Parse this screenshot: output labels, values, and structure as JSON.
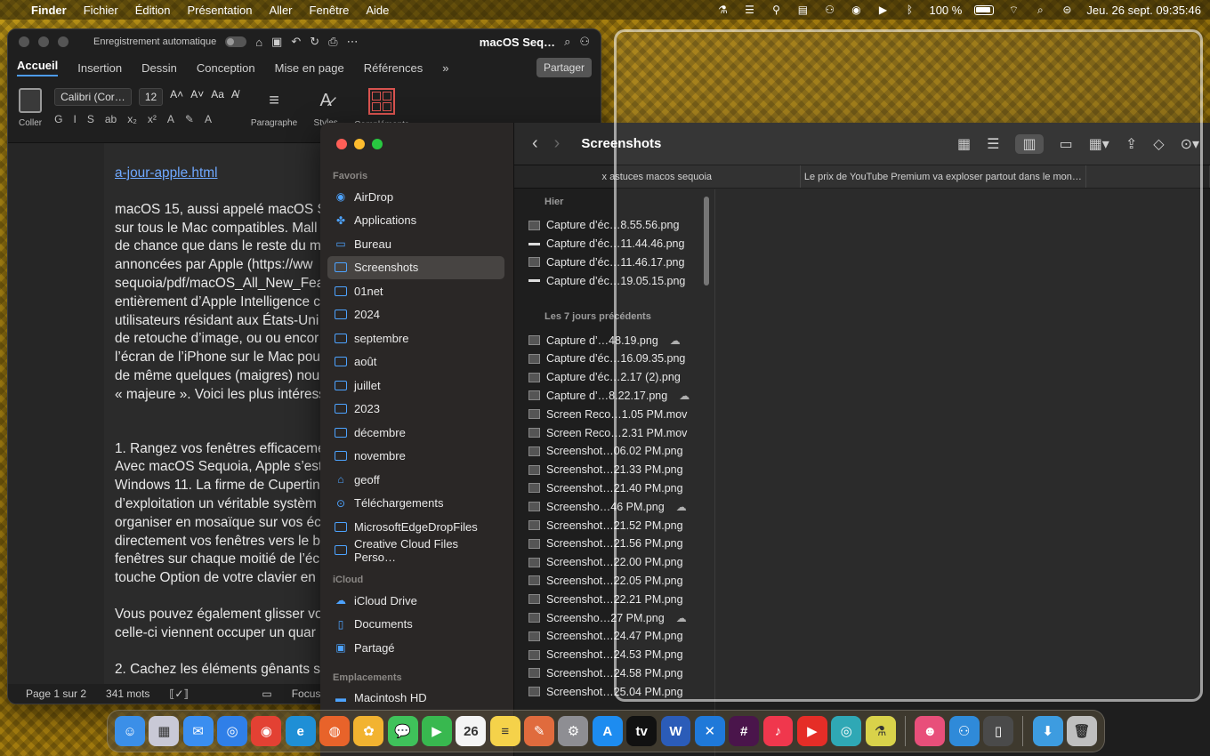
{
  "menubar": {
    "apple_icon": "apple-logo",
    "app_name": "Finder",
    "menus": [
      "Fichier",
      "Édition",
      "Présentation",
      "Aller",
      "Fenêtre",
      "Aide"
    ],
    "battery": "100 %",
    "datetime": "Jeu. 26 sept.  09:35:46"
  },
  "word": {
    "autosave": "Enregistrement automatique",
    "title": "macOS Seq…",
    "tabs": [
      "Accueil",
      "Insertion",
      "Dessin",
      "Conception",
      "Mise en page",
      "Références"
    ],
    "share": "Partager",
    "paste_label": "Coller",
    "font_name": "Calibri (Cor…",
    "font_size": "12",
    "paragraph_label": "Paragraphe",
    "styles_label": "Styles",
    "addins_label": "Compléments",
    "doc_lines": {
      "link": "a-jour-apple.html",
      "p1": [
        "macOS 15, aussi appelé macOS Se",
        "sur tous le Mac compatibles. Mall",
        "de chance que dans le reste du m",
        "annoncées par Apple (https://ww",
        "sequoia/pdf/macOS_All_New_Fea",
        "entièrement d’Apple Intelligence c",
        "utilisateurs résidant aux États-Uni",
        "de retouche d’image, ou ou encor",
        "l’écran de l’iPhone sur le Mac pou",
        "de même quelques (maigres) nou",
        "« majeure ». Voici les plus intéress"
      ],
      "p2": [
        "1. Rangez vos fenêtres efficaceme",
        "Avec macOS Sequoia, Apple s’est",
        "Windows 11. La firme de Cupertin",
        "d’exploitation un véritable systèm",
        "organiser en mosaïque sur vos écr",
        "directement vos fenêtres vers le b",
        "fenêtres sur chaque moitié de l’éc",
        "touche Option de votre clavier en"
      ],
      "p3": [
        "Vous pouvez également glisser vo",
        "celle-ci viennent occuper un quar"
      ],
      "p4": [
        "2. Cachez les éléments gênants su"
      ]
    },
    "status": {
      "page": "Page 1 sur 2",
      "words": "341 mots",
      "focus": "Focus"
    }
  },
  "finder": {
    "title": "Screenshots",
    "tabs": [
      "x astuces macos sequoia",
      "Le prix de YouTube Premium va exploser partout dans le mon…"
    ],
    "sidebar": {
      "favoris_header": "Favoris",
      "favoris": [
        {
          "label": "AirDrop",
          "icon": "airdrop-icon"
        },
        {
          "label": "Applications",
          "icon": "applications-icon"
        },
        {
          "label": "Bureau",
          "icon": "desktop-icon"
        },
        {
          "label": "Screenshots",
          "icon": "folder-icon",
          "selected": true
        },
        {
          "label": "01net",
          "icon": "folder-icon"
        },
        {
          "label": "2024",
          "icon": "folder-icon"
        },
        {
          "label": "septembre",
          "icon": "folder-icon"
        },
        {
          "label": "août",
          "icon": "folder-icon"
        },
        {
          "label": "juillet",
          "icon": "folder-icon"
        },
        {
          "label": "2023",
          "icon": "folder-icon"
        },
        {
          "label": "décembre",
          "icon": "folder-icon"
        },
        {
          "label": "novembre",
          "icon": "folder-icon"
        },
        {
          "label": "geoff",
          "icon": "home-icon"
        },
        {
          "label": "Téléchargements",
          "icon": "downloads-icon"
        },
        {
          "label": "MicrosoftEdgeDropFiles",
          "icon": "folder-icon"
        },
        {
          "label": "Creative Cloud Files Perso…",
          "icon": "folder-icon"
        }
      ],
      "icloud_header": "iCloud",
      "icloud": [
        {
          "label": "iCloud Drive",
          "icon": "icloud-icon"
        },
        {
          "label": "Documents",
          "icon": "document-icon"
        },
        {
          "label": "Partagé",
          "icon": "shared-folder-icon"
        }
      ],
      "locations_header": "Emplacements",
      "locations": [
        {
          "label": "Macintosh HD",
          "icon": "disk-icon"
        }
      ]
    },
    "groups": [
      {
        "header": "Hier",
        "files": [
          {
            "name": "Capture d’éc…8.55.56.png",
            "cloud": false,
            "thumb": "box"
          },
          {
            "name": "Capture d’éc…11.44.46.png",
            "cloud": false,
            "thumb": "line"
          },
          {
            "name": "Capture d’éc…11.46.17.png",
            "cloud": false,
            "thumb": "box"
          },
          {
            "name": "Capture d’éc…19.05.15.png",
            "cloud": false,
            "thumb": "line"
          }
        ]
      },
      {
        "header": "Les 7 jours précédents",
        "files": [
          {
            "name": "Capture d’…48.19.png",
            "cloud": true,
            "thumb": "box"
          },
          {
            "name": "Capture d’éc…16.09.35.png",
            "cloud": false,
            "thumb": "box"
          },
          {
            "name": "Capture d’éc…2.17 (2).png",
            "cloud": false,
            "thumb": "box"
          },
          {
            "name": "Capture d’…8.22.17.png",
            "cloud": true,
            "thumb": "box"
          },
          {
            "name": "Screen Reco…1.05 PM.mov",
            "cloud": false,
            "thumb": "box"
          },
          {
            "name": "Screen Reco…2.31 PM.mov",
            "cloud": false,
            "thumb": "box"
          },
          {
            "name": "Screenshot…06.02 PM.png",
            "cloud": false,
            "thumb": "box"
          },
          {
            "name": "Screenshot…21.33 PM.png",
            "cloud": false,
            "thumb": "box"
          },
          {
            "name": "Screenshot…21.40 PM.png",
            "cloud": false,
            "thumb": "box"
          },
          {
            "name": "Screensho…46 PM.png",
            "cloud": true,
            "thumb": "box"
          },
          {
            "name": "Screenshot…21.52 PM.png",
            "cloud": false,
            "thumb": "box"
          },
          {
            "name": "Screenshot…21.56 PM.png",
            "cloud": false,
            "thumb": "box"
          },
          {
            "name": "Screenshot…22.00 PM.png",
            "cloud": false,
            "thumb": "box"
          },
          {
            "name": "Screenshot…22.05 PM.png",
            "cloud": false,
            "thumb": "box"
          },
          {
            "name": "Screenshot…22.21 PM.png",
            "cloud": false,
            "thumb": "box"
          },
          {
            "name": "Screensho…27 PM.png",
            "cloud": true,
            "thumb": "box"
          },
          {
            "name": "Screenshot…24.47 PM.png",
            "cloud": false,
            "thumb": "box"
          },
          {
            "name": "Screenshot…24.53 PM.png",
            "cloud": false,
            "thumb": "box"
          },
          {
            "name": "Screenshot…24.58 PM.png",
            "cloud": false,
            "thumb": "box"
          },
          {
            "name": "Screenshot…25.04 PM.png",
            "cloud": false,
            "thumb": "box"
          }
        ]
      }
    ]
  },
  "dock": {
    "items": [
      {
        "name": "finder",
        "color": "#3b8fe8",
        "glyph": "☺"
      },
      {
        "name": "launchpad",
        "color": "#c9c9d6",
        "glyph": "▦"
      },
      {
        "name": "mail",
        "color": "#3a8ef0",
        "glyph": "✉"
      },
      {
        "name": "safari",
        "color": "#2f7fe8",
        "glyph": "◎"
      },
      {
        "name": "chrome",
        "color": "#e34133",
        "glyph": "◉"
      },
      {
        "name": "edge",
        "color": "#1f8fd6",
        "glyph": "e"
      },
      {
        "name": "firefox",
        "color": "#e8632a",
        "glyph": "◍"
      },
      {
        "name": "photos",
        "color": "#f2b330",
        "glyph": "✿"
      },
      {
        "name": "messages",
        "color": "#3fc25a",
        "glyph": "💬"
      },
      {
        "name": "facetime",
        "color": "#38b84f",
        "glyph": "▶"
      },
      {
        "name": "calendar",
        "color": "#f4f4f4",
        "glyph": "26"
      },
      {
        "name": "notes",
        "color": "#f5d24a",
        "glyph": "≡"
      },
      {
        "name": "pixelmator",
        "color": "#e06b3d",
        "glyph": "✎"
      },
      {
        "name": "system-settings",
        "color": "#8e8e93",
        "glyph": "⚙"
      },
      {
        "name": "app-store",
        "color": "#1d8cf0",
        "glyph": "A"
      },
      {
        "name": "apple-tv",
        "color": "#111111",
        "glyph": "tv"
      },
      {
        "name": "word",
        "color": "#2b5cb8",
        "glyph": "W"
      },
      {
        "name": "xcode-tools",
        "color": "#1f79d9",
        "glyph": "✕"
      },
      {
        "name": "slack",
        "color": "#4a154b",
        "glyph": "#"
      },
      {
        "name": "music",
        "color": "#f0374d",
        "glyph": "♪"
      },
      {
        "name": "youtube-music",
        "color": "#e52d27",
        "glyph": "▶"
      },
      {
        "name": "screenshot-app",
        "color": "#2fa8b5",
        "glyph": "◎"
      },
      {
        "name": "flask-app",
        "color": "#d9d24a",
        "glyph": "⚗"
      },
      {
        "name": "robot-app",
        "color": "#e84f7a",
        "glyph": "☻"
      },
      {
        "name": "ifixit",
        "color": "#2f8ad9",
        "glyph": "⚇"
      },
      {
        "name": "iphone-mirroring",
        "color": "#4a4a4a",
        "glyph": "▯"
      },
      {
        "name": "downloads-folder",
        "color": "#3d9ce0",
        "glyph": "⬇"
      },
      {
        "name": "trash",
        "color": "#bfbfbf",
        "glyph": "🗑"
      }
    ],
    "separator_before": [
      "robot-app",
      "downloads-folder"
    ]
  },
  "colors": {
    "accent": "#4da3ff",
    "close": "#ff5f57",
    "minimize": "#febc2e",
    "zoom": "#28c840"
  }
}
